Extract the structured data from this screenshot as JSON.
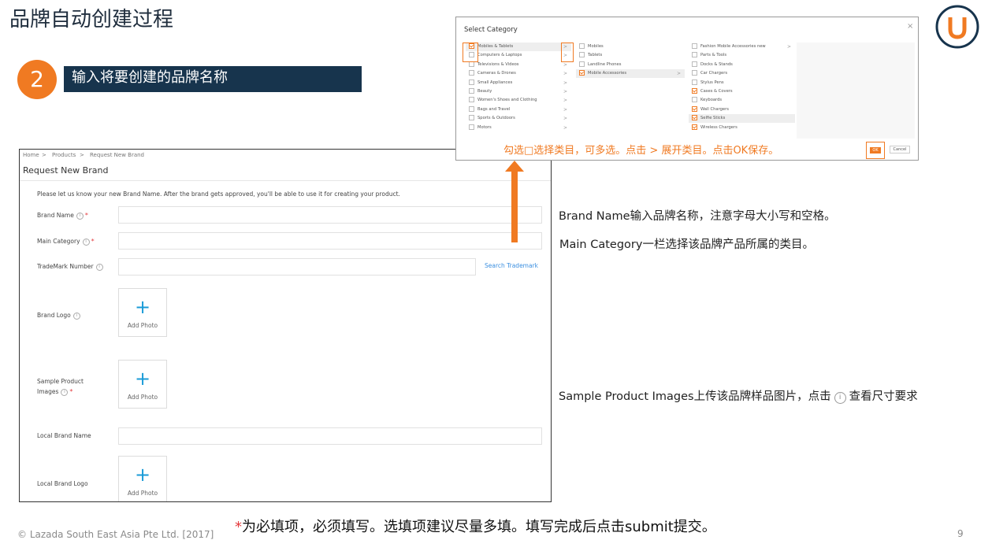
{
  "slide": {
    "title": "品牌自动创建过程",
    "step_number": "2",
    "step_text": "输入将要创建的品牌名称",
    "accent_color": "#f07a22",
    "bar_color": "#17344d"
  },
  "form": {
    "breadcrumb": [
      "Home",
      "Products",
      "Request New Brand"
    ],
    "title": "Request New Brand",
    "intro": "Please let us know your new Brand Name. After the brand gets approved, you'll be able to use it for creating your product.",
    "brand_name_label": "Brand Name",
    "main_category_label": "Main Category",
    "trademark_label": "TradeMark Number",
    "search_trademark": "Search Trademark",
    "brand_logo_label": "Brand Logo",
    "sample_images_label_1": "Sample Product",
    "sample_images_label_2": "Images",
    "local_brand_name_label": "Local Brand Name",
    "local_brand_logo_label": "Local Brand Logo",
    "add_photo": "Add Photo",
    "plus": "+",
    "info": "i",
    "required": "*"
  },
  "dialog": {
    "title": "Select Category",
    "close": "×",
    "chevron": ">",
    "col1": [
      {
        "label": "Mobiles & Tablets",
        "checked": true
      },
      {
        "label": "Computers & Laptops",
        "checked": false
      },
      {
        "label": "Televisions & Videos",
        "checked": false
      },
      {
        "label": "Cameras & Drones",
        "checked": false
      },
      {
        "label": "Small Appliances",
        "checked": false
      },
      {
        "label": "Beauty",
        "checked": false
      },
      {
        "label": "Women's Shoes and Clothing",
        "checked": false
      },
      {
        "label": "Bags and Travel",
        "checked": false
      },
      {
        "label": "Sports & Outdoors",
        "checked": false
      },
      {
        "label": "Motors",
        "checked": false
      }
    ],
    "col2": [
      {
        "label": "Mobiles",
        "checked": false
      },
      {
        "label": "Tablets",
        "checked": false
      },
      {
        "label": "Landline Phones",
        "checked": false
      },
      {
        "label": "Mobile Accessories",
        "checked": true
      }
    ],
    "col3": [
      {
        "label": "Fashion Mobile Accessories new",
        "checked": false
      },
      {
        "label": "Parts & Tools",
        "checked": false
      },
      {
        "label": "Docks & Stands",
        "checked": false
      },
      {
        "label": "Car Chargers",
        "checked": false
      },
      {
        "label": "Stylus Pens",
        "checked": false
      },
      {
        "label": "Cases & Covers",
        "checked": true
      },
      {
        "label": "Keyboards",
        "checked": false
      },
      {
        "label": "Wall Chargers",
        "checked": true
      },
      {
        "label": "Selfie Sticks",
        "checked": true
      },
      {
        "label": "Wireless Chargers",
        "checked": true
      }
    ],
    "hint": "勾选□选择类目，可多选。点击 > 展开类目。点击OK保存。",
    "ok": "OK",
    "cancel": "Cancel"
  },
  "notes": {
    "brand_name": "Brand Name输入品牌名称，注意字母大小写和空格。",
    "main_category": "Main Category一栏选择该品牌产品所属的类目。",
    "sample_images_a": "Sample Product Images上传该品牌样品图片，点击",
    "sample_images_icon": "i",
    "sample_images_b": "查看尺寸要求",
    "bottom_star": "*",
    "bottom": "为必填项，必须填写。选填项建议尽量多填。填写完成后点击submit提交。",
    "copyright": "© Lazada South East Asia Pte Ltd. [2017]",
    "page_number": "9"
  }
}
